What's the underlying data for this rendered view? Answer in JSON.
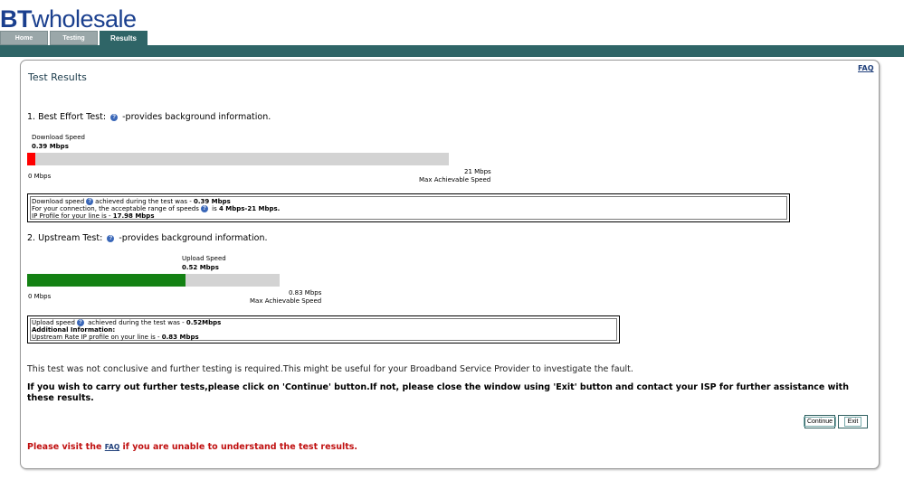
{
  "brand": {
    "bt": "BT",
    "rest": "wholesale"
  },
  "tabs": [
    {
      "label": "Home"
    },
    {
      "label": "Testing"
    },
    {
      "label": "Results"
    }
  ],
  "faq_link": "FAQ",
  "title": "Test Results",
  "download_test": {
    "heading_prefix": "1. Best Effort Test:",
    "heading_suffix": "-provides background information.",
    "caption": "Download  Speed",
    "value": "0.39 Mbps",
    "min_label": "0 Mbps",
    "max_label": "21 Mbps",
    "max_caption": "Max Achievable Speed",
    "speed_mbps": 0.39,
    "max_mbps": 21,
    "fill_color": "#ff0000",
    "info": {
      "l1_a": "Download speed",
      "l1_b": "achieved during the test was - ",
      "l1_value": "0.39 Mbps",
      "l2_a": "For your connection, the acceptable range of speeds",
      "l2_b": " is ",
      "l2_value": "4 Mbps-21 Mbps.",
      "l3_a": "IP Profile for your line is - ",
      "l3_value": "17.98 Mbps"
    }
  },
  "upload_test": {
    "heading_prefix": "2. Upstream Test:",
    "heading_suffix": "-provides background information.",
    "caption": "Upload Speed",
    "value": "0.52 Mbps",
    "min_label": "0 Mbps",
    "max_label": "0.83 Mbps",
    "max_caption": "Max Achievable Speed",
    "speed_mbps": 0.52,
    "max_mbps": 0.83,
    "fill_color": "#138113",
    "info": {
      "l1_a": "Upload speed",
      "l1_b": " achieved during the test was - ",
      "l1_value": "0.52Mbps",
      "l2": "Additional Information:",
      "l3_a": "Upstream Rate IP profile on your line is - ",
      "l3_value": "0.83 Mbps"
    }
  },
  "message_inconclusive": "This test was not conclusive and further testing is required.This might be useful for your Broadband Service Provider to investigate the fault.",
  "message_continue": "If you wish to carry out further tests,please click on 'Continue' button.If not, please close the window using 'Exit' button and contact your ISP for further assistance with these results.",
  "buttons": {
    "continue": "Continue",
    "exit": "Exit"
  },
  "visit": {
    "prefix": "Please visit the ",
    "link": "FAQ",
    "suffix": " if you are unable to understand the test results."
  },
  "help_glyph": "?",
  "colors": {
    "brand_blue": "#1a3f8e",
    "header_teal": "#2f6567",
    "alert_red": "#c01010"
  }
}
